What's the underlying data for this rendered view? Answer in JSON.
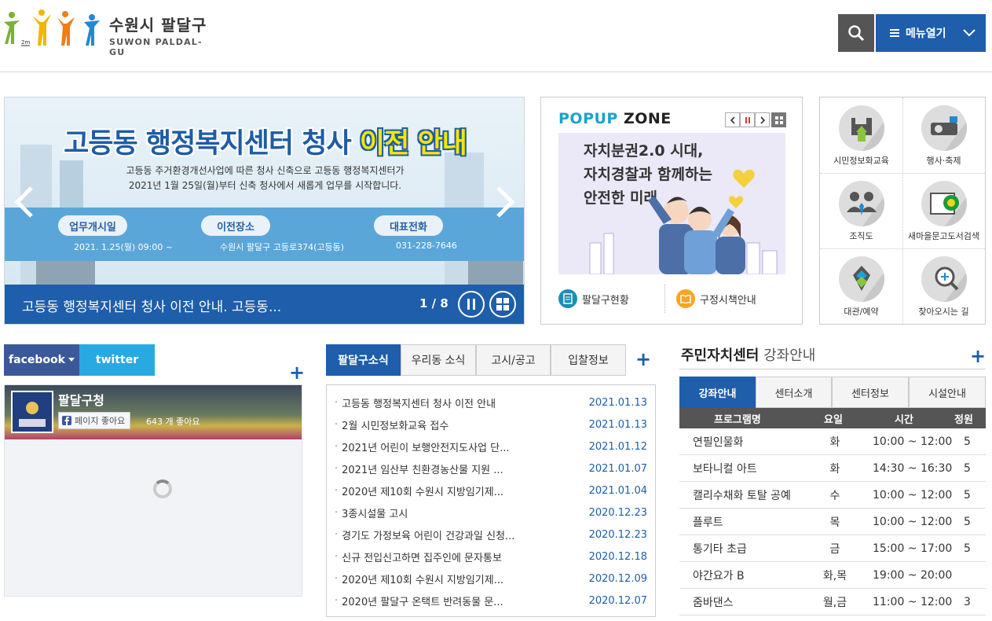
{
  "header": {
    "logo_ko": "수원시 팔달구",
    "logo_en": "SUWON PALDAL-GU",
    "menu_label": "메뉴열기"
  },
  "banner": {
    "title_main": "고등동 행정복지센터 청사 ",
    "title_highlight": "이전 안내",
    "sub1": "고등동 주거환경개선사업에 따른 청사 신축으로 고등동 행정복지센터가",
    "sub2": "2021년 1월 25일(월)부터 신축 청사에서 새롭게 업무를 시작합니다.",
    "pills": [
      {
        "label": "업무개시일",
        "value": "2021. 1.25(월) 09:00 ~"
      },
      {
        "label": "이전장소",
        "value": "수원시 팔달구 고등로374(고등동)"
      },
      {
        "label": "대표전화",
        "value": "031-228-7646"
      }
    ],
    "caption": "고등동 행정복지센터 청사 이전 안내. 고등동...",
    "counter": "1 / 8"
  },
  "popup": {
    "title_a": "POPUP",
    "title_b": " ZONE",
    "image_text_1": "자치분권2.0 시대,",
    "image_text_2": "자치경찰과 함께하는",
    "image_text_3": "안전한 미래",
    "link1": "팔달구현황",
    "link2": "구정시책안내"
  },
  "quick": {
    "items": [
      {
        "label": "시민정보화교육",
        "icon": "floppy-disk-icon"
      },
      {
        "label": "행사·축제",
        "icon": "projector-icon"
      },
      {
        "label": "조직도",
        "icon": "people-icon"
      },
      {
        "label": "새마을문고도서검색",
        "icon": "book-icon"
      },
      {
        "label": "대관/예약",
        "icon": "reservation-icon"
      },
      {
        "label": "찾아오시는 길",
        "icon": "magnifier-icon"
      }
    ]
  },
  "sns": {
    "tab_facebook": "facebook",
    "tab_twitter": "twitter",
    "page_name": "팔달구청",
    "like_label": "페이지 좋아요",
    "like_count": "643 개 좋아요"
  },
  "news": {
    "tabs": [
      "팔달구소식",
      "우리동 소식",
      "고시/공고",
      "입찰정보"
    ],
    "items": [
      {
        "title": "고등동 행정복지센터 청사 이전 안내",
        "date": "2021.01.13"
      },
      {
        "title": "2월 시민정보화교육 접수",
        "date": "2021.01.13"
      },
      {
        "title": "2021년 어린이 보행안전지도사업 단...",
        "date": "2021.01.12"
      },
      {
        "title": "2021년 임산부 친환경농산물 지원 ...",
        "date": "2021.01.07"
      },
      {
        "title": "2020년 제10회 수원시 지방임기제...",
        "date": "2021.01.04"
      },
      {
        "title": "3종시설물 고시",
        "date": "2020.12.23"
      },
      {
        "title": "경기도 가정보육 어린이 건강과일 신청...",
        "date": "2020.12.23"
      },
      {
        "title": "신규 전입신고하면 집주인에 문자통보",
        "date": "2020.12.18"
      },
      {
        "title": "2020년 제10회 수원시 지방임기제...",
        "date": "2020.12.09"
      },
      {
        "title": "2020년 팔달구 온택트 반려동물 문...",
        "date": "2020.12.07"
      }
    ]
  },
  "lecture": {
    "title": "주민자치센터",
    "title_sub": " 강좌안내",
    "tabs": [
      "강좌안내",
      "센터소개",
      "센터정보",
      "시설안내"
    ],
    "headers": [
      "프로그램명",
      "요일",
      "시간",
      "정원"
    ],
    "rows": [
      {
        "name": "연필인물화",
        "day": "화",
        "time": "10:00 ~ 12:00",
        "cap": "5"
      },
      {
        "name": "보타니컬 아트",
        "day": "화",
        "time": "14:30 ~ 16:30",
        "cap": "5"
      },
      {
        "name": "캘리수채화 토탈 공예",
        "day": "수",
        "time": "10:00 ~ 12:00",
        "cap": "5"
      },
      {
        "name": "플루트",
        "day": "목",
        "time": "10:00 ~ 12:00",
        "cap": "5"
      },
      {
        "name": "통기타 초급",
        "day": "금",
        "time": "15:00 ~ 17:00",
        "cap": "5"
      },
      {
        "name": "야간요가 B",
        "day": "화,목",
        "time": "19:00 ~ 20:00",
        "cap": ""
      },
      {
        "name": "줌바댄스",
        "day": "월,금",
        "time": "11:00 ~ 12:00",
        "cap": "3"
      }
    ]
  },
  "colors": {
    "brand": "#1e5eab",
    "facebook": "#3b5998",
    "twitter": "#29a9e1",
    "popup_accent": "#1aa3c8"
  }
}
